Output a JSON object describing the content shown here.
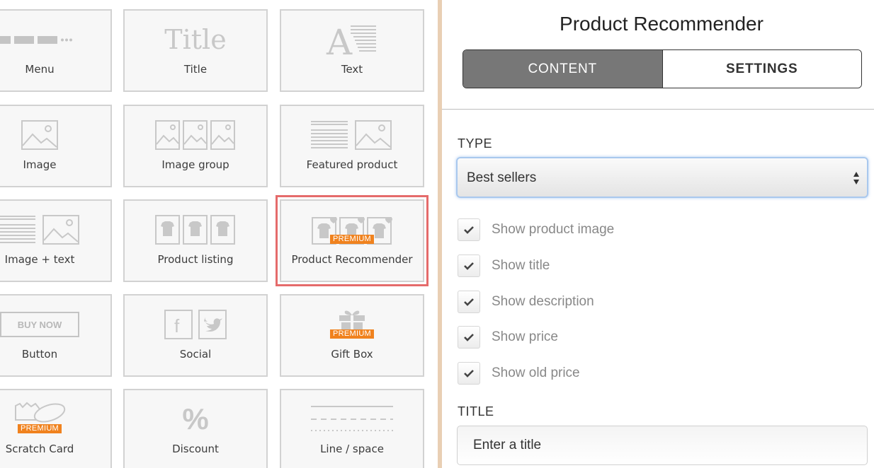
{
  "blocks": [
    {
      "label": "Menu",
      "icon": "menu-icon",
      "premium": false
    },
    {
      "label": "Title",
      "icon": "title-icon",
      "premium": false,
      "icon_text": "Title"
    },
    {
      "label": "Text",
      "icon": "text-icon",
      "premium": false
    },
    {
      "label": "Image",
      "icon": "image-icon",
      "premium": false
    },
    {
      "label": "Image group",
      "icon": "image-group-icon",
      "premium": false
    },
    {
      "label": "Featured product",
      "icon": "featured-product-icon",
      "premium": false
    },
    {
      "label": "Image + text",
      "icon": "image-text-icon",
      "premium": false
    },
    {
      "label": "Product listing",
      "icon": "product-listing-icon",
      "premium": false
    },
    {
      "label": "Product Recommender",
      "icon": "product-recommender-icon",
      "premium": true,
      "selected": true
    },
    {
      "label": "Button",
      "icon": "button-icon",
      "premium": false,
      "icon_text": "BUY NOW"
    },
    {
      "label": "Social",
      "icon": "social-icon",
      "premium": false
    },
    {
      "label": "Gift Box",
      "icon": "gift-box-icon",
      "premium": true
    },
    {
      "label": "Scratch Card",
      "icon": "scratch-card-icon",
      "premium": true
    },
    {
      "label": "Discount",
      "icon": "discount-icon",
      "premium": false,
      "icon_text": "%"
    },
    {
      "label": "Line / space",
      "icon": "line-space-icon",
      "premium": false
    }
  ],
  "premium_label": "PREMIUM",
  "panel": {
    "title": "Product Recommender",
    "tabs": [
      {
        "label": "CONTENT",
        "active": true
      },
      {
        "label": "SETTINGS",
        "active": false
      }
    ],
    "type_label": "TYPE",
    "type_value": "Best sellers",
    "checkboxes": [
      {
        "label": "Show product image",
        "checked": true
      },
      {
        "label": "Show title",
        "checked": true
      },
      {
        "label": "Show description",
        "checked": true
      },
      {
        "label": "Show price",
        "checked": true
      },
      {
        "label": "Show old price",
        "checked": true
      }
    ],
    "title_label": "TITLE",
    "title_placeholder": "Enter a title"
  },
  "colors": {
    "premium": "#f0821e",
    "selected_outline": "#e56b6b",
    "divider": "#e9cfb4",
    "active_tab": "#777777",
    "select_focus": "#a9c8ee"
  }
}
